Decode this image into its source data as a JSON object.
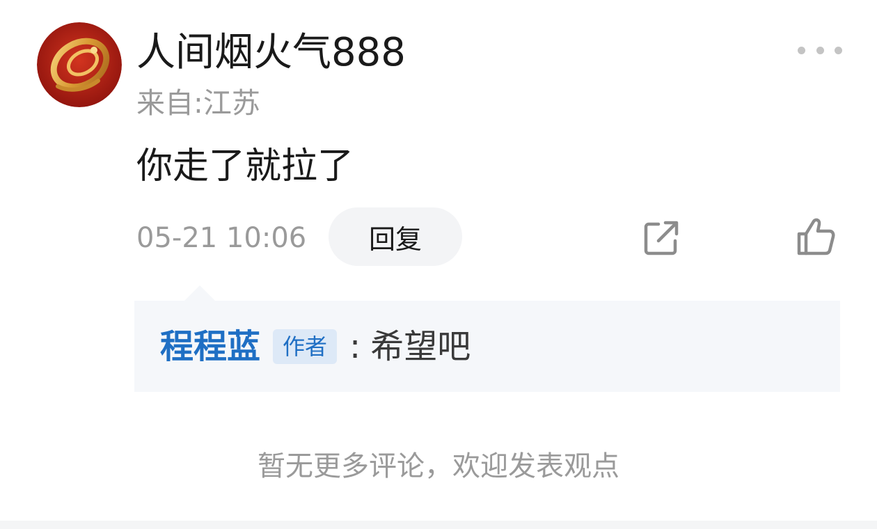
{
  "comment": {
    "username": "人间烟火气888",
    "location": "来自:江苏",
    "text": "你走了就拉了",
    "timestamp": "05-21 10:06",
    "reply_label": "回复",
    "avatar_icon": "golden-snake-icon",
    "more_icon": "more-dots-icon",
    "share_icon": "share-icon",
    "like_icon": "thumbs-up-icon"
  },
  "reply": {
    "author": "程程蓝",
    "badge": "作者",
    "separator": ":",
    "content": "希望吧"
  },
  "footer": {
    "no_more_text": "暂无更多评论，欢迎发表观点"
  },
  "colors": {
    "link_blue": "#1f6fc4",
    "muted_gray": "#9a9a9a",
    "avatar_red": "#b51a14",
    "avatar_gold": "#e0a33a"
  }
}
